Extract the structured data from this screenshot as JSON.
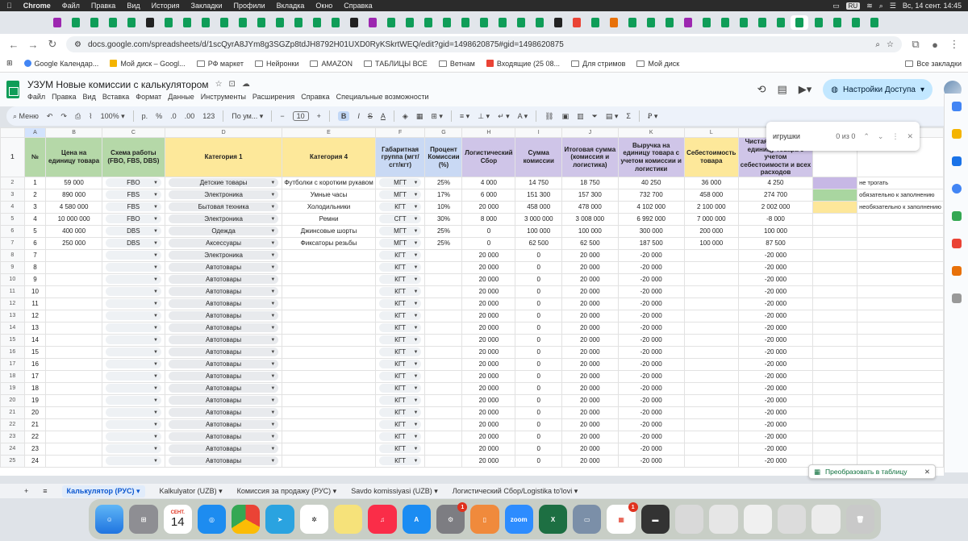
{
  "mac": {
    "app": "Chrome",
    "menu": [
      "Файл",
      "Правка",
      "Вид",
      "История",
      "Закладки",
      "Профили",
      "Вкладка",
      "Окно",
      "Справка"
    ],
    "lang": "RU",
    "clock": "Вс, 14 сент. 14:45"
  },
  "browser": {
    "url": "docs.google.com/spreadsheets/d/1scQyrA8JYm8g3SGZp8tdJH8792H01UXD0RyKSkrtWEQ/edit?gid=1498620875#gid=1498620875",
    "bookmarks": [
      {
        "label": "Google Календар...",
        "icon": "calendar-icon"
      },
      {
        "label": "Мой диск – Googl...",
        "icon": "drive-icon"
      },
      {
        "label": "РФ маркет",
        "icon": "folder-icon"
      },
      {
        "label": "Нейронки",
        "icon": "folder-icon"
      },
      {
        "label": "AMAZON",
        "icon": "folder-icon"
      },
      {
        "label": "ТАБЛИЦЫ ВСЕ",
        "icon": "folder-icon"
      },
      {
        "label": "Ветнам",
        "icon": "folder-icon"
      },
      {
        "label": "Входящие (25 08...",
        "icon": "gmail-icon"
      },
      {
        "label": "Для стримов",
        "icon": "folder-icon"
      },
      {
        "label": "Мой диск",
        "icon": "folder-icon"
      }
    ],
    "all_bookmarks": "Все закладки"
  },
  "doc": {
    "title": "УЗУМ Новые комиссии с калькулятором",
    "menus": [
      "Файл",
      "Правка",
      "Вид",
      "Вставка",
      "Формат",
      "Данные",
      "Инструменты",
      "Расширения",
      "Справка",
      "Специальные возможности"
    ],
    "share": "Настройки Доступа"
  },
  "toolbar": {
    "search": "Меню",
    "zoom": "100%",
    "currency": "р.",
    "percent": "%",
    "dec1": ".0",
    "dec2": ".00",
    "num": "123",
    "font": "По ум...",
    "size": "10"
  },
  "formula": {
    "ref": "A1",
    "value": "№"
  },
  "find": {
    "query": "игрушки",
    "count": "0 из 0"
  },
  "grid": {
    "columns": [
      "A",
      "B",
      "C",
      "D",
      "E",
      "F",
      "G",
      "H",
      "I",
      "J",
      "K",
      "L",
      "M"
    ],
    "headers": [
      "№",
      "Цена на единицу товара",
      "Схема работы (FBO, FBS, DBS)",
      "Категория 1",
      "Категория 4",
      "Габаритная группа (мгт/сгт/кгт)",
      "Процент Комиссии (%)",
      "Логистический Сбор",
      "Сумма комиссии",
      "Итоговая сумма (комиссия и логистика)",
      "Выручка на единицу товара с учетом комиссии и логистики",
      "Себестоимость товара",
      "Чистая выручка на единицу товара с учетом себестоимости и всех расходов"
    ],
    "rows": [
      {
        "n": "1",
        "price": "59 000",
        "scheme": "FBO",
        "cat1": "Детские товары",
        "cat4": "Футболки с коротким рукавом",
        "size": "МГТ",
        "pct": "25%",
        "log": "4 000",
        "comm": "14 750",
        "total": "18 750",
        "rev": "40 250",
        "cost": "36 000",
        "net": "4 250"
      },
      {
        "n": "2",
        "price": "890 000",
        "scheme": "FBS",
        "cat1": "Электроника",
        "cat4": "Умные часы",
        "size": "МГТ",
        "pct": "17%",
        "log": "6 000",
        "comm": "151 300",
        "total": "157 300",
        "rev": "732 700",
        "cost": "458 000",
        "net": "274 700"
      },
      {
        "n": "3",
        "price": "4 580 000",
        "scheme": "FBS",
        "cat1": "Бытовая техника",
        "cat4": "Холодильники",
        "size": "КГТ",
        "pct": "10%",
        "log": "20 000",
        "comm": "458 000",
        "total": "478 000",
        "rev": "4 102 000",
        "cost": "2 100 000",
        "net": "2 002 000"
      },
      {
        "n": "4",
        "price": "10 000 000",
        "scheme": "FBO",
        "cat1": "Электроника",
        "cat4": "Ремни",
        "size": "СГТ",
        "pct": "30%",
        "log": "8 000",
        "comm": "3 000 000",
        "total": "3 008 000",
        "rev": "6 992 000",
        "cost": "7 000 000",
        "net": "-8 000"
      },
      {
        "n": "5",
        "price": "400 000",
        "scheme": "DBS",
        "cat1": "Одежда",
        "cat4": "Джинсовые шорты",
        "size": "МГТ",
        "pct": "25%",
        "log": "0",
        "comm": "100 000",
        "total": "100 000",
        "rev": "300 000",
        "cost": "200 000",
        "net": "100 000"
      },
      {
        "n": "6",
        "price": "250 000",
        "scheme": "DBS",
        "cat1": "Аксессуары",
        "cat4": "Фиксаторы резьбы",
        "size": "МГТ",
        "pct": "25%",
        "log": "0",
        "comm": "62 500",
        "total": "62 500",
        "rev": "187 500",
        "cost": "100 000",
        "net": "87 500"
      },
      {
        "n": "7",
        "price": "",
        "scheme": "",
        "cat1": "Электроника",
        "cat4": "",
        "size": "КГТ",
        "pct": "",
        "log": "20 000",
        "comm": "0",
        "total": "20 000",
        "rev": "-20 000",
        "cost": "",
        "net": "-20 000"
      },
      {
        "n": "8",
        "price": "",
        "scheme": "",
        "cat1": "Автотовары",
        "cat4": "",
        "size": "КГТ",
        "pct": "",
        "log": "20 000",
        "comm": "0",
        "total": "20 000",
        "rev": "-20 000",
        "cost": "",
        "net": "-20 000"
      },
      {
        "n": "9",
        "price": "",
        "scheme": "",
        "cat1": "Автотовары",
        "cat4": "",
        "size": "КГТ",
        "pct": "",
        "log": "20 000",
        "comm": "0",
        "total": "20 000",
        "rev": "-20 000",
        "cost": "",
        "net": "-20 000"
      },
      {
        "n": "10",
        "price": "",
        "scheme": "",
        "cat1": "Автотовары",
        "cat4": "",
        "size": "КГТ",
        "pct": "",
        "log": "20 000",
        "comm": "0",
        "total": "20 000",
        "rev": "-20 000",
        "cost": "",
        "net": "-20 000"
      },
      {
        "n": "11",
        "price": "",
        "scheme": "",
        "cat1": "Автотовары",
        "cat4": "",
        "size": "КГТ",
        "pct": "",
        "log": "20 000",
        "comm": "0",
        "total": "20 000",
        "rev": "-20 000",
        "cost": "",
        "net": "-20 000"
      },
      {
        "n": "12",
        "price": "",
        "scheme": "",
        "cat1": "Автотовары",
        "cat4": "",
        "size": "КГТ",
        "pct": "",
        "log": "20 000",
        "comm": "0",
        "total": "20 000",
        "rev": "-20 000",
        "cost": "",
        "net": "-20 000"
      },
      {
        "n": "13",
        "price": "",
        "scheme": "",
        "cat1": "Автотовары",
        "cat4": "",
        "size": "КГТ",
        "pct": "",
        "log": "20 000",
        "comm": "0",
        "total": "20 000",
        "rev": "-20 000",
        "cost": "",
        "net": "-20 000"
      },
      {
        "n": "14",
        "price": "",
        "scheme": "",
        "cat1": "Автотовары",
        "cat4": "",
        "size": "КГТ",
        "pct": "",
        "log": "20 000",
        "comm": "0",
        "total": "20 000",
        "rev": "-20 000",
        "cost": "",
        "net": "-20 000"
      },
      {
        "n": "15",
        "price": "",
        "scheme": "",
        "cat1": "Автотовары",
        "cat4": "",
        "size": "КГТ",
        "pct": "",
        "log": "20 000",
        "comm": "0",
        "total": "20 000",
        "rev": "-20 000",
        "cost": "",
        "net": "-20 000"
      },
      {
        "n": "16",
        "price": "",
        "scheme": "",
        "cat1": "Автотовары",
        "cat4": "",
        "size": "КГТ",
        "pct": "",
        "log": "20 000",
        "comm": "0",
        "total": "20 000",
        "rev": "-20 000",
        "cost": "",
        "net": "-20 000"
      },
      {
        "n": "17",
        "price": "",
        "scheme": "",
        "cat1": "Автотовары",
        "cat4": "",
        "size": "КГТ",
        "pct": "",
        "log": "20 000",
        "comm": "0",
        "total": "20 000",
        "rev": "-20 000",
        "cost": "",
        "net": "-20 000"
      },
      {
        "n": "18",
        "price": "",
        "scheme": "",
        "cat1": "Автотовары",
        "cat4": "",
        "size": "КГТ",
        "pct": "",
        "log": "20 000",
        "comm": "0",
        "total": "20 000",
        "rev": "-20 000",
        "cost": "",
        "net": "-20 000"
      },
      {
        "n": "19",
        "price": "",
        "scheme": "",
        "cat1": "Автотовары",
        "cat4": "",
        "size": "КГТ",
        "pct": "",
        "log": "20 000",
        "comm": "0",
        "total": "20 000",
        "rev": "-20 000",
        "cost": "",
        "net": "-20 000"
      },
      {
        "n": "20",
        "price": "",
        "scheme": "",
        "cat1": "Автотовары",
        "cat4": "",
        "size": "КГТ",
        "pct": "",
        "log": "20 000",
        "comm": "0",
        "total": "20 000",
        "rev": "-20 000",
        "cost": "",
        "net": "-20 000"
      },
      {
        "n": "21",
        "price": "",
        "scheme": "",
        "cat1": "Автотовары",
        "cat4": "",
        "size": "КГТ",
        "pct": "",
        "log": "20 000",
        "comm": "0",
        "total": "20 000",
        "rev": "-20 000",
        "cost": "",
        "net": "-20 000"
      },
      {
        "n": "22",
        "price": "",
        "scheme": "",
        "cat1": "Автотовары",
        "cat4": "",
        "size": "КГТ",
        "pct": "",
        "log": "20 000",
        "comm": "0",
        "total": "20 000",
        "rev": "-20 000",
        "cost": "",
        "net": "-20 000"
      },
      {
        "n": "23",
        "price": "",
        "scheme": "",
        "cat1": "Автотовары",
        "cat4": "",
        "size": "КГТ",
        "pct": "",
        "log": "20 000",
        "comm": "0",
        "total": "20 000",
        "rev": "-20 000",
        "cost": "",
        "net": "-20 000"
      },
      {
        "n": "24",
        "price": "",
        "scheme": "",
        "cat1": "Автотовары",
        "cat4": "",
        "size": "КГТ",
        "pct": "",
        "log": "20 000",
        "comm": "0",
        "total": "20 000",
        "rev": "-20 000",
        "cost": "",
        "net": "-20 000"
      }
    ],
    "notes": [
      {
        "row": 0,
        "text": "не трогать",
        "color": "#c7b8e5"
      },
      {
        "row": 1,
        "text": "обязательно к заполнению",
        "color": "#a9d6a0"
      },
      {
        "row": 2,
        "text": "необязательно к заполнению",
        "color": "#fde79a"
      }
    ]
  },
  "convert_chip": "Преобразовать в таблицу",
  "sheet_tabs": [
    "Калькулятор (РУС)",
    "Kalkulyator (UZB)",
    "Комиссия за продажу (РУС)",
    "Savdo komissiyasi (UZB)",
    "Логистический Сбор/Logistika to'lovi"
  ],
  "dock": {
    "calendar_month": "СЕНТ.",
    "calendar_day": "14",
    "zoom_label": "zoom"
  }
}
